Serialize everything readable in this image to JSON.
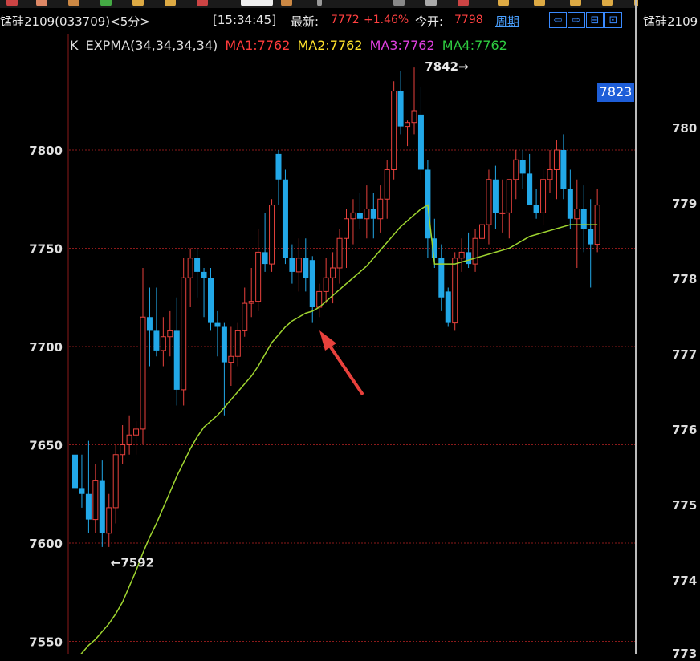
{
  "header": {
    "title": "锰硅2109(033709)<5分>",
    "time": "[15:34:45]",
    "latest_label": "最新:",
    "latest_value": "7772",
    "change": "+1.46%",
    "open_label": "今开:",
    "open_value": "7798",
    "period": "周期",
    "nav_buttons": [
      "⇦",
      "⇨",
      "⊟",
      "⊡"
    ]
  },
  "legend": {
    "k": "K",
    "expma": "EXPMA(34,34,34,34)",
    "ma1": "MA1:7762",
    "ma2": "MA2:7762",
    "ma3": "MA3:7762",
    "ma4": "MA4:7762"
  },
  "colors": {
    "up": "#e8413c",
    "down": "#22a8e8",
    "ma_line": "#9fd530",
    "ma1": "#ff3b3b",
    "ma2": "#ffe22b",
    "ma3": "#e040e0",
    "ma4": "#2ecc40",
    "grid": "#8b1a1a",
    "arrow": "#e8413c"
  },
  "price_tag": "7823",
  "right_panel": {
    "title": "锰硅2109",
    "ticks": [
      "780",
      "779",
      "778",
      "777",
      "776",
      "775",
      "774",
      "773"
    ]
  },
  "chart_data": {
    "type": "candlestick",
    "ylim": [
      7540,
      7860
    ],
    "yticks": [
      7550,
      7600,
      7650,
      7700,
      7750,
      7800
    ],
    "grid": true,
    "annotations": [
      {
        "text": "7842→",
        "price": 7842,
        "bar": 58
      },
      {
        "text": "←7592",
        "price": 7592,
        "bar": 5
      }
    ],
    "candles": [
      [
        7645,
        7648,
        7620,
        7628
      ],
      [
        7628,
        7645,
        7618,
        7625
      ],
      [
        7625,
        7652,
        7605,
        7612
      ],
      [
        7612,
        7640,
        7605,
        7632
      ],
      [
        7632,
        7642,
        7598,
        7605
      ],
      [
        7605,
        7625,
        7598,
        7618
      ],
      [
        7618,
        7650,
        7610,
        7645
      ],
      [
        7645,
        7660,
        7640,
        7650
      ],
      [
        7650,
        7665,
        7645,
        7655
      ],
      [
        7655,
        7662,
        7645,
        7658
      ],
      [
        7658,
        7740,
        7650,
        7715
      ],
      [
        7715,
        7730,
        7690,
        7708
      ],
      [
        7708,
        7730,
        7695,
        7698
      ],
      [
        7698,
        7715,
        7690,
        7705
      ],
      [
        7705,
        7718,
        7695,
        7708
      ],
      [
        7708,
        7725,
        7670,
        7678
      ],
      [
        7678,
        7745,
        7670,
        7735
      ],
      [
        7735,
        7750,
        7720,
        7745
      ],
      [
        7745,
        7750,
        7725,
        7738
      ],
      [
        7738,
        7740,
        7715,
        7735
      ],
      [
        7735,
        7740,
        7708,
        7712
      ],
      [
        7712,
        7718,
        7695,
        7710
      ],
      [
        7710,
        7712,
        7665,
        7692
      ],
      [
        7692,
        7710,
        7680,
        7695
      ],
      [
        7695,
        7712,
        7690,
        7708
      ],
      [
        7708,
        7730,
        7705,
        7722
      ],
      [
        7722,
        7740,
        7715,
        7723
      ],
      [
        7723,
        7760,
        7718,
        7748
      ],
      [
        7748,
        7768,
        7738,
        7742
      ],
      [
        7742,
        7775,
        7738,
        7772
      ],
      [
        7798,
        7800,
        7772,
        7785
      ],
      [
        7785,
        7790,
        7742,
        7745
      ],
      [
        7745,
        7752,
        7732,
        7738
      ],
      [
        7738,
        7755,
        7728,
        7745
      ],
      [
        7745,
        7755,
        7728,
        7735
      ],
      [
        7744,
        7746,
        7712,
        7720
      ],
      [
        7720,
        7732,
        7715,
        7728
      ],
      [
        7728,
        7745,
        7722,
        7735
      ],
      [
        7735,
        7748,
        7722,
        7740
      ],
      [
        7740,
        7760,
        7732,
        7755
      ],
      [
        7755,
        7770,
        7740,
        7765
      ],
      [
        7765,
        7775,
        7752,
        7768
      ],
      [
        7768,
        7778,
        7760,
        7765
      ],
      [
        7765,
        7782,
        7755,
        7770
      ],
      [
        7770,
        7778,
        7755,
        7765
      ],
      [
        7765,
        7782,
        7758,
        7775
      ],
      [
        7775,
        7795,
        7765,
        7790
      ],
      [
        7790,
        7835,
        7785,
        7830
      ],
      [
        7830,
        7840,
        7808,
        7812
      ],
      [
        7812,
        7815,
        7802,
        7814
      ],
      [
        7814,
        7842,
        7808,
        7820
      ],
      [
        7818,
        7832,
        7785,
        7790
      ],
      [
        7790,
        7795,
        7745,
        7755
      ],
      [
        7755,
        7765,
        7740,
        7745
      ],
      [
        7745,
        7752,
        7718,
        7725
      ],
      [
        7728,
        7730,
        7710,
        7712
      ],
      [
        7712,
        7748,
        7708,
        7745
      ],
      [
        7745,
        7755,
        7738,
        7748
      ],
      [
        7748,
        7758,
        7740,
        7742
      ],
      [
        7742,
        7760,
        7738,
        7755
      ],
      [
        7755,
        7775,
        7748,
        7762
      ],
      [
        7762,
        7790,
        7752,
        7785
      ],
      [
        7785,
        7792,
        7760,
        7768
      ],
      [
        7768,
        7785,
        7758,
        7768
      ],
      [
        7768,
        7785,
        7755,
        7785
      ],
      [
        7785,
        7800,
        7775,
        7795
      ],
      [
        7795,
        7800,
        7780,
        7788
      ],
      [
        7788,
        7798,
        7772,
        7772
      ],
      [
        7772,
        7780,
        7765,
        7768
      ],
      [
        7768,
        7790,
        7762,
        7785
      ],
      [
        7785,
        7800,
        7778,
        7790
      ],
      [
        7790,
        7805,
        7775,
        7800
      ],
      [
        7800,
        7808,
        7775,
        7780
      ],
      [
        7780,
        7790,
        7760,
        7765
      ],
      [
        7765,
        7785,
        7740,
        7770
      ],
      [
        7770,
        7782,
        7748,
        7760
      ],
      [
        7760,
        7775,
        7730,
        7752
      ],
      [
        7752,
        7780,
        7748,
        7772
      ]
    ],
    "ma": [
      7540,
      7544,
      7548,
      7551,
      7555,
      7559,
      7564,
      7570,
      7578,
      7586,
      7595,
      7603,
      7610,
      7618,
      7626,
      7634,
      7641,
      7648,
      7654,
      7659,
      7662,
      7665,
      7669,
      7673,
      7677,
      7681,
      7685,
      7690,
      7696,
      7702,
      7706,
      7710,
      7713,
      7715,
      7717,
      7718,
      7720,
      7723,
      7726,
      7729,
      7732,
      7735,
      7738,
      7741,
      7745,
      7749,
      7753,
      7757,
      7761,
      7764,
      7767,
      7770,
      7772,
      7742,
      7742,
      7742,
      7742,
      7743,
      7744,
      7745,
      7746,
      7747,
      7748,
      7749,
      7750,
      7752,
      7754,
      7756,
      7757,
      7758,
      7759,
      7760,
      7761,
      7762,
      7762,
      7762,
      7762,
      7762
    ]
  }
}
